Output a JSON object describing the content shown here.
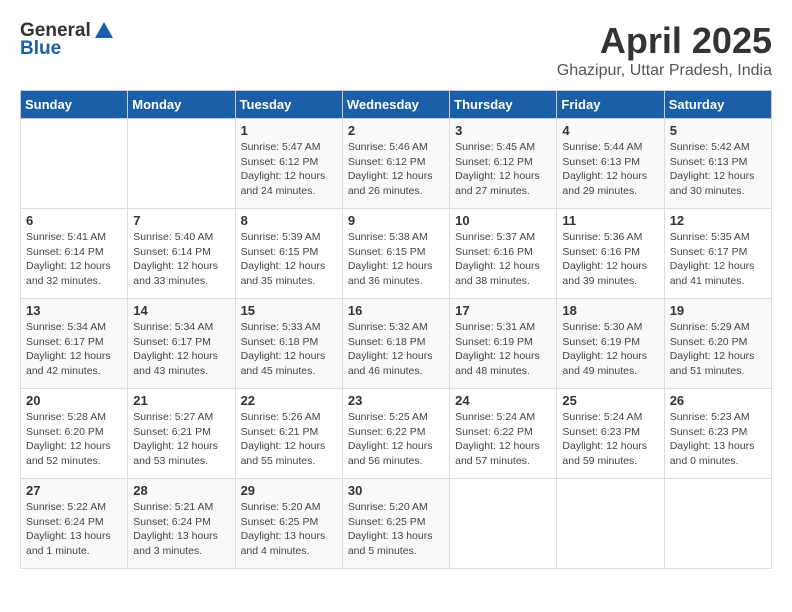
{
  "header": {
    "logo_general": "General",
    "logo_blue": "Blue",
    "month_title": "April 2025",
    "location": "Ghazipur, Uttar Pradesh, India"
  },
  "weekdays": [
    "Sunday",
    "Monday",
    "Tuesday",
    "Wednesday",
    "Thursday",
    "Friday",
    "Saturday"
  ],
  "weeks": [
    [
      {
        "day": "",
        "sunrise": "",
        "sunset": "",
        "daylight": ""
      },
      {
        "day": "",
        "sunrise": "",
        "sunset": "",
        "daylight": ""
      },
      {
        "day": "1",
        "sunrise": "Sunrise: 5:47 AM",
        "sunset": "Sunset: 6:12 PM",
        "daylight": "Daylight: 12 hours and 24 minutes."
      },
      {
        "day": "2",
        "sunrise": "Sunrise: 5:46 AM",
        "sunset": "Sunset: 6:12 PM",
        "daylight": "Daylight: 12 hours and 26 minutes."
      },
      {
        "day": "3",
        "sunrise": "Sunrise: 5:45 AM",
        "sunset": "Sunset: 6:12 PM",
        "daylight": "Daylight: 12 hours and 27 minutes."
      },
      {
        "day": "4",
        "sunrise": "Sunrise: 5:44 AM",
        "sunset": "Sunset: 6:13 PM",
        "daylight": "Daylight: 12 hours and 29 minutes."
      },
      {
        "day": "5",
        "sunrise": "Sunrise: 5:42 AM",
        "sunset": "Sunset: 6:13 PM",
        "daylight": "Daylight: 12 hours and 30 minutes."
      }
    ],
    [
      {
        "day": "6",
        "sunrise": "Sunrise: 5:41 AM",
        "sunset": "Sunset: 6:14 PM",
        "daylight": "Daylight: 12 hours and 32 minutes."
      },
      {
        "day": "7",
        "sunrise": "Sunrise: 5:40 AM",
        "sunset": "Sunset: 6:14 PM",
        "daylight": "Daylight: 12 hours and 33 minutes."
      },
      {
        "day": "8",
        "sunrise": "Sunrise: 5:39 AM",
        "sunset": "Sunset: 6:15 PM",
        "daylight": "Daylight: 12 hours and 35 minutes."
      },
      {
        "day": "9",
        "sunrise": "Sunrise: 5:38 AM",
        "sunset": "Sunset: 6:15 PM",
        "daylight": "Daylight: 12 hours and 36 minutes."
      },
      {
        "day": "10",
        "sunrise": "Sunrise: 5:37 AM",
        "sunset": "Sunset: 6:16 PM",
        "daylight": "Daylight: 12 hours and 38 minutes."
      },
      {
        "day": "11",
        "sunrise": "Sunrise: 5:36 AM",
        "sunset": "Sunset: 6:16 PM",
        "daylight": "Daylight: 12 hours and 39 minutes."
      },
      {
        "day": "12",
        "sunrise": "Sunrise: 5:35 AM",
        "sunset": "Sunset: 6:17 PM",
        "daylight": "Daylight: 12 hours and 41 minutes."
      }
    ],
    [
      {
        "day": "13",
        "sunrise": "Sunrise: 5:34 AM",
        "sunset": "Sunset: 6:17 PM",
        "daylight": "Daylight: 12 hours and 42 minutes."
      },
      {
        "day": "14",
        "sunrise": "Sunrise: 5:34 AM",
        "sunset": "Sunset: 6:17 PM",
        "daylight": "Daylight: 12 hours and 43 minutes."
      },
      {
        "day": "15",
        "sunrise": "Sunrise: 5:33 AM",
        "sunset": "Sunset: 6:18 PM",
        "daylight": "Daylight: 12 hours and 45 minutes."
      },
      {
        "day": "16",
        "sunrise": "Sunrise: 5:32 AM",
        "sunset": "Sunset: 6:18 PM",
        "daylight": "Daylight: 12 hours and 46 minutes."
      },
      {
        "day": "17",
        "sunrise": "Sunrise: 5:31 AM",
        "sunset": "Sunset: 6:19 PM",
        "daylight": "Daylight: 12 hours and 48 minutes."
      },
      {
        "day": "18",
        "sunrise": "Sunrise: 5:30 AM",
        "sunset": "Sunset: 6:19 PM",
        "daylight": "Daylight: 12 hours and 49 minutes."
      },
      {
        "day": "19",
        "sunrise": "Sunrise: 5:29 AM",
        "sunset": "Sunset: 6:20 PM",
        "daylight": "Daylight: 12 hours and 51 minutes."
      }
    ],
    [
      {
        "day": "20",
        "sunrise": "Sunrise: 5:28 AM",
        "sunset": "Sunset: 6:20 PM",
        "daylight": "Daylight: 12 hours and 52 minutes."
      },
      {
        "day": "21",
        "sunrise": "Sunrise: 5:27 AM",
        "sunset": "Sunset: 6:21 PM",
        "daylight": "Daylight: 12 hours and 53 minutes."
      },
      {
        "day": "22",
        "sunrise": "Sunrise: 5:26 AM",
        "sunset": "Sunset: 6:21 PM",
        "daylight": "Daylight: 12 hours and 55 minutes."
      },
      {
        "day": "23",
        "sunrise": "Sunrise: 5:25 AM",
        "sunset": "Sunset: 6:22 PM",
        "daylight": "Daylight: 12 hours and 56 minutes."
      },
      {
        "day": "24",
        "sunrise": "Sunrise: 5:24 AM",
        "sunset": "Sunset: 6:22 PM",
        "daylight": "Daylight: 12 hours and 57 minutes."
      },
      {
        "day": "25",
        "sunrise": "Sunrise: 5:24 AM",
        "sunset": "Sunset: 6:23 PM",
        "daylight": "Daylight: 12 hours and 59 minutes."
      },
      {
        "day": "26",
        "sunrise": "Sunrise: 5:23 AM",
        "sunset": "Sunset: 6:23 PM",
        "daylight": "Daylight: 13 hours and 0 minutes."
      }
    ],
    [
      {
        "day": "27",
        "sunrise": "Sunrise: 5:22 AM",
        "sunset": "Sunset: 6:24 PM",
        "daylight": "Daylight: 13 hours and 1 minute."
      },
      {
        "day": "28",
        "sunrise": "Sunrise: 5:21 AM",
        "sunset": "Sunset: 6:24 PM",
        "daylight": "Daylight: 13 hours and 3 minutes."
      },
      {
        "day": "29",
        "sunrise": "Sunrise: 5:20 AM",
        "sunset": "Sunset: 6:25 PM",
        "daylight": "Daylight: 13 hours and 4 minutes."
      },
      {
        "day": "30",
        "sunrise": "Sunrise: 5:20 AM",
        "sunset": "Sunset: 6:25 PM",
        "daylight": "Daylight: 13 hours and 5 minutes."
      },
      {
        "day": "",
        "sunrise": "",
        "sunset": "",
        "daylight": ""
      },
      {
        "day": "",
        "sunrise": "",
        "sunset": "",
        "daylight": ""
      },
      {
        "day": "",
        "sunrise": "",
        "sunset": "",
        "daylight": ""
      }
    ]
  ]
}
